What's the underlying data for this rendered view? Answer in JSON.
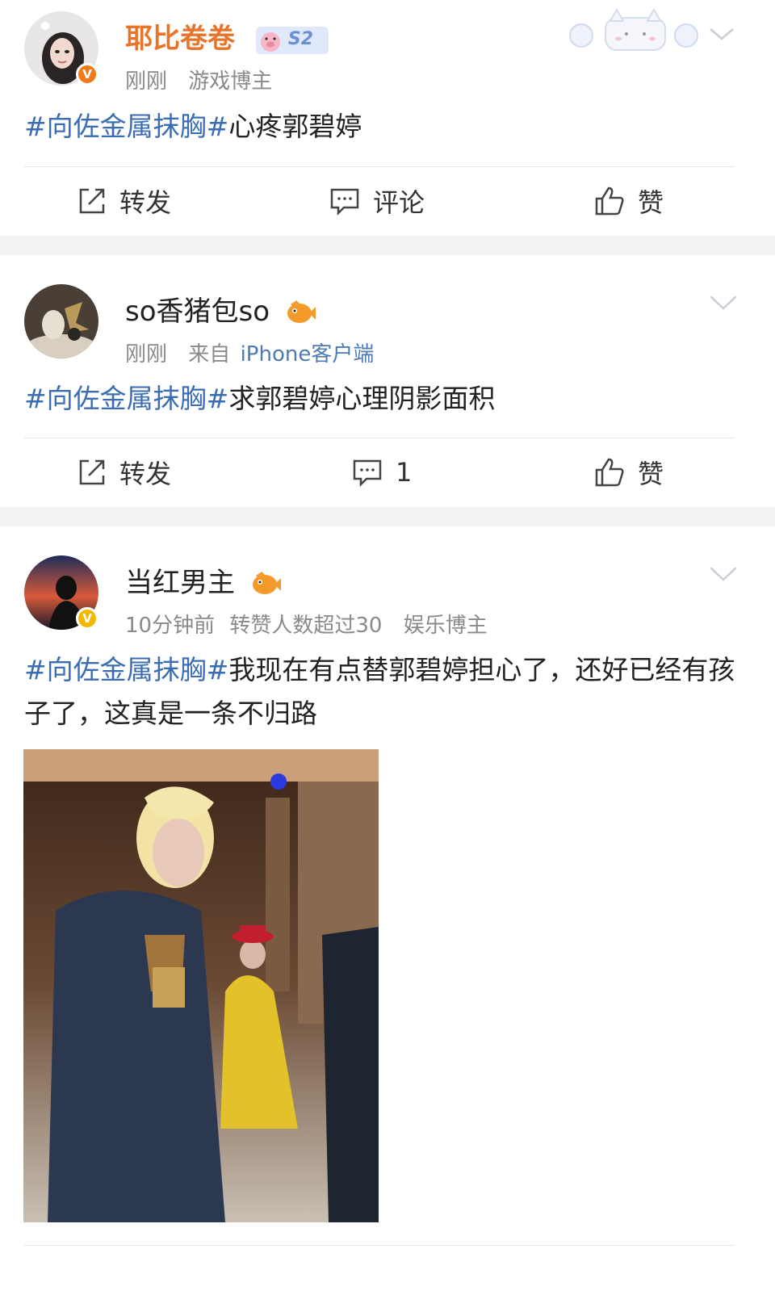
{
  "posts": [
    {
      "author": "耶比卷卷",
      "badge": "S2",
      "time": "刚刚",
      "tag_label": "游戏博主",
      "hashtag": "#向佐金属抹胸#",
      "text": "心疼郭碧婷",
      "actions": {
        "repost": "转发",
        "comment": "评论",
        "like": "赞"
      }
    },
    {
      "author": "so香猪包so",
      "time": "刚刚",
      "source_prefix": "来自",
      "source": "iPhone客户端",
      "hashtag": "#向佐金属抹胸#",
      "text": "求郭碧婷心理阴影面积",
      "actions": {
        "repost": "转发",
        "comment": "1",
        "like": "赞"
      }
    },
    {
      "author": "当红男主",
      "time": "10分钟前",
      "stat": "转赞人数超过30",
      "tag_label": "娱乐博主",
      "hashtag": "#向佐金属抹胸#",
      "text": "我现在有点替郭碧婷担心了，还好已经有孩子了，这真是一条不归路"
    }
  ],
  "colors": {
    "accent_link": "#3b6db4",
    "name_orange": "#e8742a",
    "badge_orange": "#f07a18",
    "badge_gold": "#f5b800"
  },
  "icons": [
    "chevron-down-icon",
    "repost-icon",
    "comment-icon",
    "like-icon",
    "verified-icon",
    "fish-emoji-icon"
  ]
}
